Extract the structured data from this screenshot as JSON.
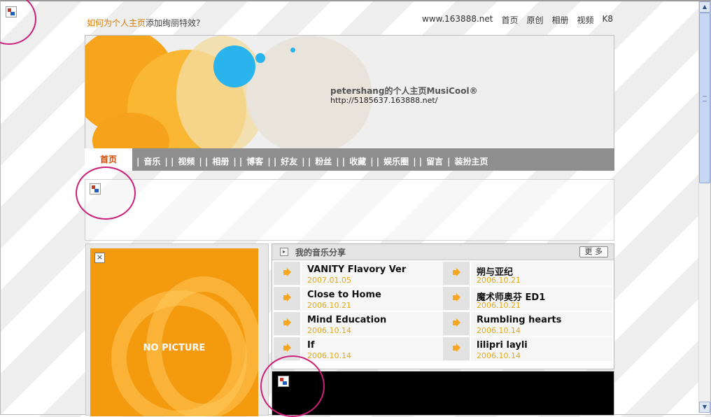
{
  "header": {
    "howto_link": "如何为个人主页",
    "howto_rest": "添加绚丽特效?",
    "topnav": [
      "www.163888.net",
      "首页",
      "原创",
      "相册",
      "视频",
      "K8"
    ]
  },
  "banner": {
    "title": "petershang的个人主页MusiCool®",
    "url": "http://5185637.163888.net/"
  },
  "nav": {
    "active": "首页",
    "items": [
      "音乐",
      "视频",
      "相册",
      "博客",
      "好友",
      "粉丝",
      "收藏",
      "娱乐圈",
      "留言"
    ],
    "last": "装扮主页"
  },
  "picture": {
    "label": "NO PICTURE",
    "close_glyph": "×"
  },
  "music": {
    "title": "我的音乐分享",
    "more": "更 多",
    "songs": [
      {
        "title": "VANITY Flavory Ver",
        "date": "2007.01.05"
      },
      {
        "title": "朔与亚纪",
        "date": "2006.10.21"
      },
      {
        "title": "Close to Home",
        "date": "2006.10.21"
      },
      {
        "title": "魔术师奥芬 ED1",
        "date": "2006.10.21"
      },
      {
        "title": "Mind Education",
        "date": "2006.10.14"
      },
      {
        "title": "Rumbling hearts",
        "date": "2006.10.14"
      },
      {
        "title": "If",
        "date": "2006.10.14"
      },
      {
        "title": "lilipri layli",
        "date": "2006.10.14"
      }
    ]
  },
  "colors": {
    "accent": "#e07a00",
    "nav_bg": "#8e8e8e",
    "picture_bg": "#f39a0f",
    "date": "#e2a91a",
    "annotation": "#cc1f7a"
  },
  "icons": {
    "broken_image": "broken-image-icon",
    "speaker": "speaker-icon",
    "close": "close-icon",
    "header_arrow": "play-arrow-icon"
  }
}
